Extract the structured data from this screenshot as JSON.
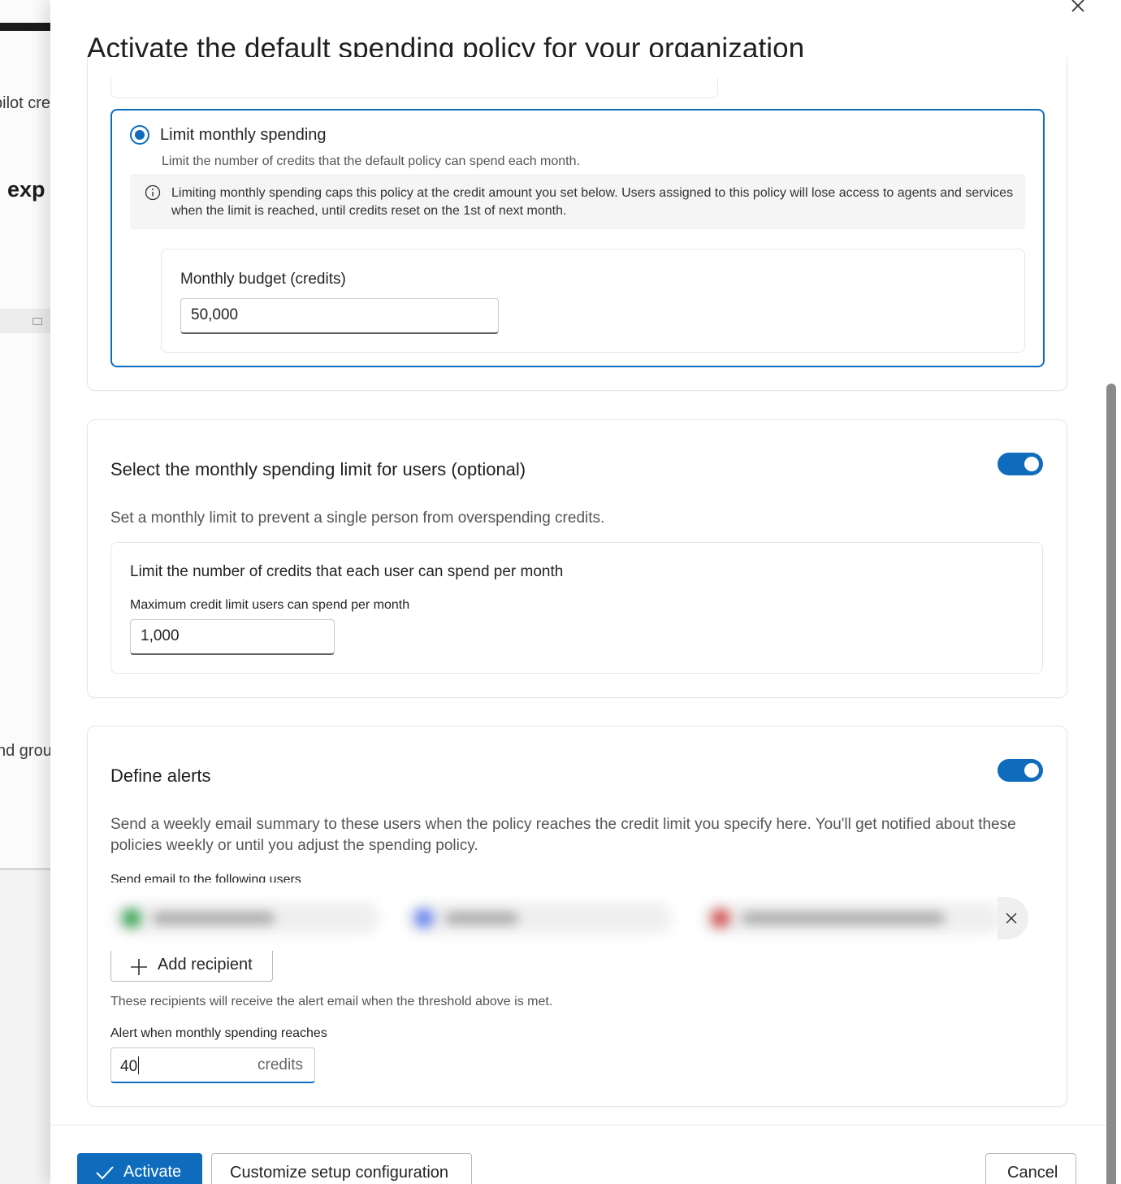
{
  "background": {
    "text_1": "pilot cre",
    "text_2": "l exp",
    "text_3": "nd grou"
  },
  "panel": {
    "title": "Activate the default spending policy for your organization",
    "close_icon": "close-icon"
  },
  "limit_option": {
    "label": "Limit monthly spending",
    "selected": true,
    "description": "Limit the number of credits that the default policy can spend each month.",
    "info": "Limiting monthly spending caps this policy at the credit amount you set below. Users assigned to this policy will lose access to agents and services when the limit is reached, until credits reset on the 1st of next month.",
    "budget_label": "Monthly budget (credits)",
    "budget_value": "50,000"
  },
  "user_limit": {
    "title": "Select the monthly spending limit for users (optional)",
    "enabled": true,
    "description": "Set a monthly limit to prevent a single person from overspending credits.",
    "card_title": "Limit the number of credits that each user can spend per month",
    "field_label": "Maximum credit limit users can spend per month",
    "field_value": "1,000"
  },
  "alerts": {
    "title": "Define alerts",
    "enabled": true,
    "description": "Send a weekly email summary to these users when the policy reaches the credit limit you specify here. You'll get notified about these policies weekly or until you adjust the spending policy.",
    "recipients_label": "Send email to the following users",
    "add_recipient_label": "Add recipient",
    "hint": "These recipients will receive the alert email when the threshold above is met.",
    "threshold_label": "Alert when monthly spending reaches",
    "threshold_value": "40",
    "threshold_suffix": "credits",
    "colors": {
      "avatar_1": "#2e9e4a",
      "avatar_2": "#5b7cf0",
      "avatar_3": "#d04a4a"
    }
  },
  "footer": {
    "activate_label": "Activate",
    "customize_label": "Customize setup configuration",
    "cancel_label": "Cancel"
  },
  "colors": {
    "accent": "#0f6cbd"
  }
}
